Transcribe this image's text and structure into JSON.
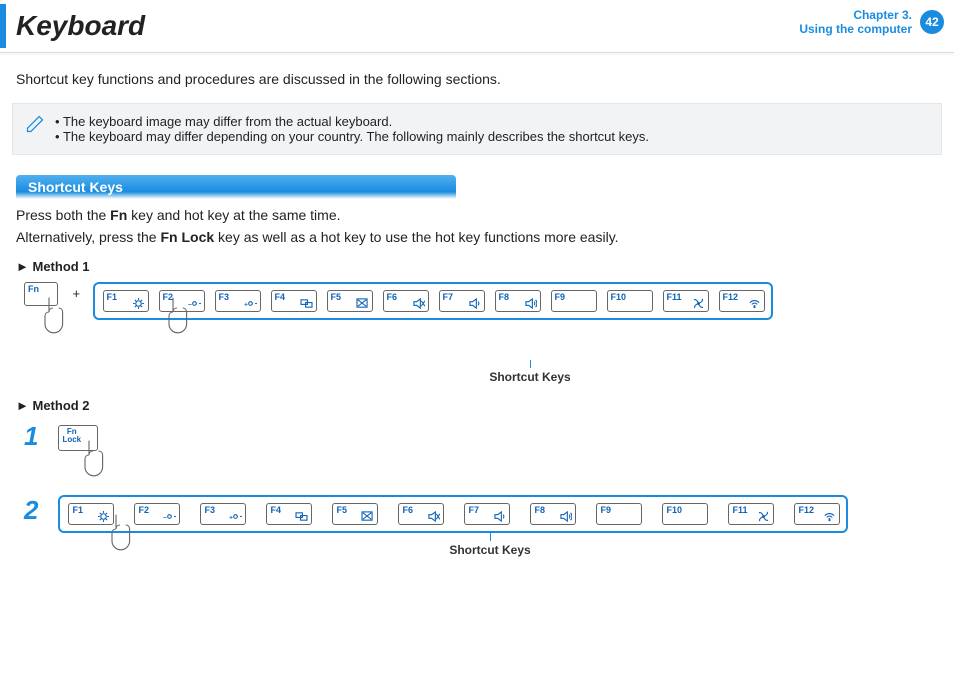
{
  "header": {
    "title": "Keyboard",
    "chapter_line1": "Chapter 3.",
    "chapter_line2": "Using the computer",
    "page_number": "42"
  },
  "intro_text": "Shortcut key functions and procedures are discussed in the following sections.",
  "notes": {
    "item1": "The keyboard image may differ from the actual keyboard.",
    "item2": "The keyboard may differ depending on your country. The following mainly describes the shortcut keys."
  },
  "section1_title": "Shortcut Keys",
  "para1_a": "Press both the ",
  "para1_b": " key and hot key at the same time.",
  "para1_fn": "Fn",
  "para2_a": "Alternatively, press the ",
  "para2_b": " key as well as a hot key to use the hot key functions more easily.",
  "para2_fnlock": "Fn Lock",
  "method1_label": "Method 1",
  "method2_label": "Method 2",
  "fn_key_label": "Fn",
  "fnlock_key_label": "Fn\nLock",
  "plus_symbol": "+",
  "fkeys": [
    "F1",
    "F2",
    "F3",
    "F4",
    "F5",
    "F6",
    "F7",
    "F8",
    "F9",
    "F10",
    "F11",
    "F12"
  ],
  "fkey_icons": [
    "settings",
    "brightness-down",
    "brightness-up",
    "display-switch",
    "touchpad-off",
    "mute",
    "volume-down",
    "volume-up",
    "",
    "",
    "fan",
    "wifi"
  ],
  "row_caption": "Shortcut Keys",
  "step1": "1",
  "step2": "2"
}
